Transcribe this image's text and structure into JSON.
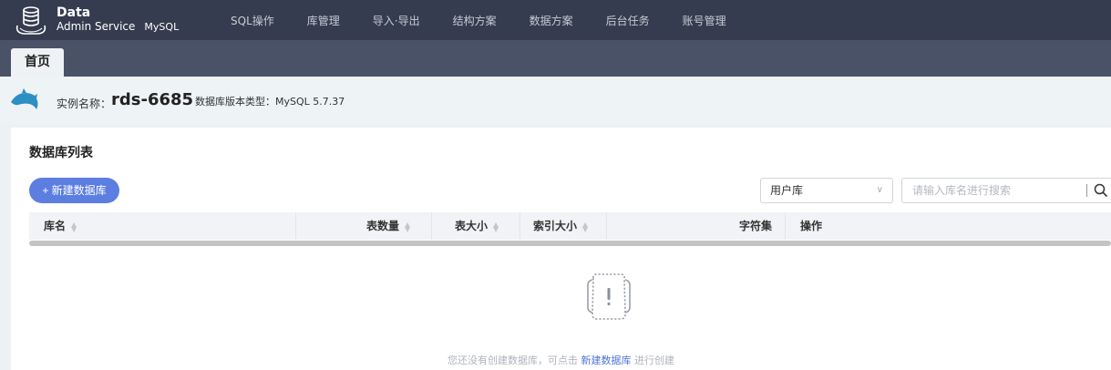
{
  "app": {
    "logo_line1": "Data",
    "logo_line2": "Admin Service",
    "logo_line3": "MySQL"
  },
  "nav": [
    "SQL操作",
    "库管理",
    "导入·导出",
    "结构方案",
    "数据方案",
    "后台任务",
    "账号管理"
  ],
  "tabs": [
    {
      "label": "首页",
      "active": true
    }
  ],
  "instance": {
    "name_label": "实例名称：",
    "name": "rds-6685",
    "version": "数据库版本类型：MySQL 5.7.37"
  },
  "panel": {
    "title": "数据库列表",
    "new_button": "+ 新建数据库",
    "filter_value": "用户库",
    "search_placeholder": "请输入库名进行搜索"
  },
  "table": {
    "columns": [
      "库名",
      "表数量",
      "表大小",
      "索引大小",
      "字符集",
      "操作"
    ],
    "rows": []
  },
  "empty": {
    "text_before": "您还没有创建数据库，可点击",
    "link": "新建数据库",
    "text_after": "进行创建"
  },
  "colors": {
    "topbar": "#353c4f",
    "tabbar": "#4a5267",
    "primary": "#5b7ee0",
    "link": "#4e74d6"
  }
}
